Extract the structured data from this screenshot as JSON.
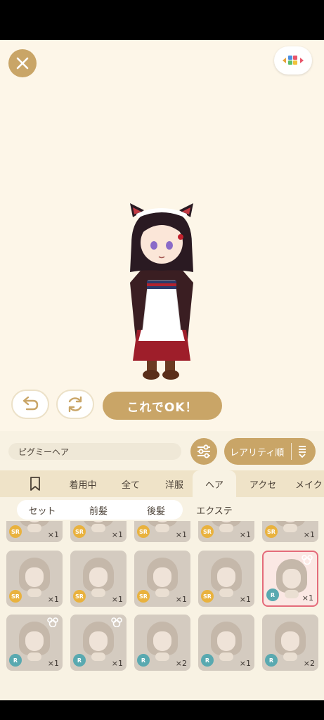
{
  "header": {
    "close_icon": "close-icon",
    "layout_icon": "color-blocks-icon"
  },
  "stage": {
    "undo_icon": "undo-icon",
    "reset_icon": "refresh-icon",
    "ok_label": "これでOK！"
  },
  "search": {
    "value": "ピグミーヘア"
  },
  "filter": {
    "icon": "sliders-icon"
  },
  "sort": {
    "label": "レアリティ順",
    "icon": "sort-down-icon"
  },
  "categories": {
    "bookmark_icon": "bookmark-icon",
    "items": [
      "着用中",
      "全て",
      "洋服",
      "ヘア",
      "アクセ",
      "メイク"
    ],
    "active": "ヘア"
  },
  "subcategories": {
    "items": [
      "セット",
      "前髪",
      "後髪",
      "エクステ"
    ],
    "active": "後髪"
  },
  "colors": {
    "accent": "#c9a567",
    "stage_bg": "#fdf6e8",
    "panel_bg": "#f8f2e3",
    "sr_badge": "#e9b23e",
    "r_badge": "#59a9b0",
    "selected_border": "#e46b7a"
  },
  "items": {
    "row0": [
      {
        "rarity": "SR",
        "count": "×1"
      },
      {
        "rarity": "SR",
        "count": "×1"
      },
      {
        "rarity": "SR",
        "count": "×1"
      },
      {
        "rarity": "SR",
        "count": "×1"
      },
      {
        "rarity": "SR",
        "count": "×1"
      }
    ],
    "row1": [
      {
        "rarity": "SR",
        "count": "×1"
      },
      {
        "rarity": "SR",
        "count": "×1"
      },
      {
        "rarity": "SR",
        "count": "×1"
      },
      {
        "rarity": "SR",
        "count": "×1"
      },
      {
        "rarity": "R",
        "count": "×1"
      }
    ],
    "row2": [
      {
        "rarity": "R",
        "count": "×1"
      },
      {
        "rarity": "R",
        "count": "×1"
      },
      {
        "rarity": "R",
        "count": "×2"
      },
      {
        "rarity": "R",
        "count": "×1"
      },
      {
        "rarity": "R",
        "count": "×2"
      }
    ]
  }
}
